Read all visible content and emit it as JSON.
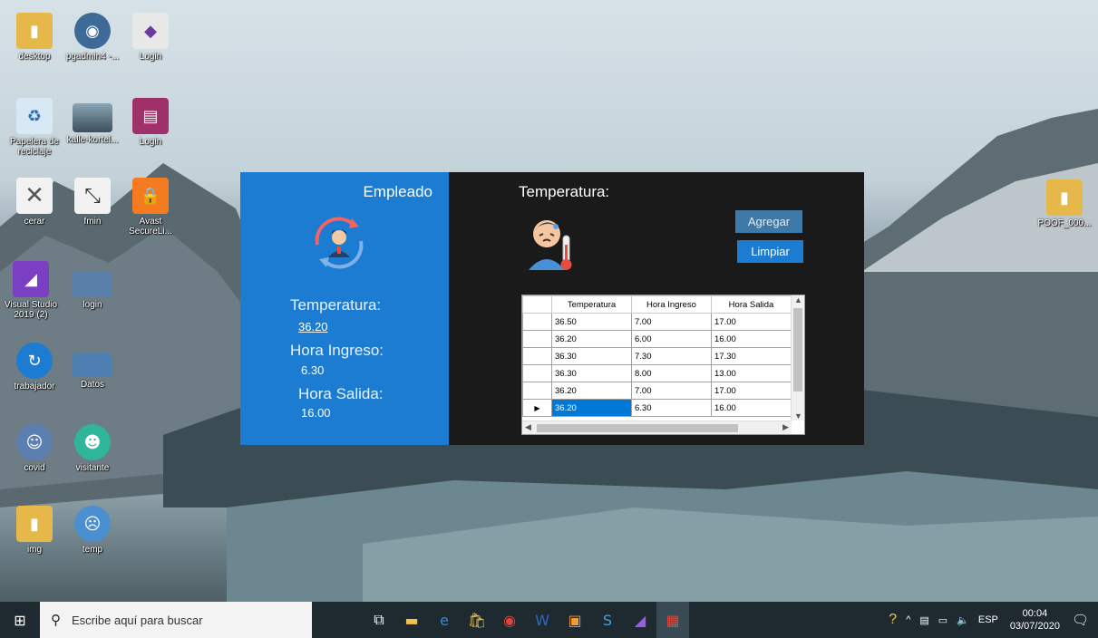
{
  "desktop": {
    "icons": [
      {
        "label": "desktop"
      },
      {
        "label": "pgadmin4 -..."
      },
      {
        "label": "Login"
      },
      {
        "label": "Papelera de reciclaje"
      },
      {
        "label": "kalle-kortel..."
      },
      {
        "label": "Login"
      },
      {
        "label": "cerar"
      },
      {
        "label": "fmin"
      },
      {
        "label": "Avast SecureLi..."
      },
      {
        "label": "Visual Studio 2019 (2)"
      },
      {
        "label": "login"
      },
      {
        "label": "trabajador"
      },
      {
        "label": "Datos"
      },
      {
        "label": "covid"
      },
      {
        "label": "visitante"
      },
      {
        "label": "img"
      },
      {
        "label": "temp"
      },
      {
        "label": "POOF_000..."
      }
    ]
  },
  "app": {
    "left": {
      "title": "Empleado",
      "temperatura_label": "Temperatura:",
      "temperatura_value": "36.20",
      "hora_ingreso_label": "Hora Ingreso:",
      "hora_ingreso_value": "6.30",
      "hora_salida_label": "Hora Salida:",
      "hora_salida_value": "16.00"
    },
    "right": {
      "title": "Temperatura:",
      "agregar_label": "Agregar",
      "limpiar_label": "Limpiar",
      "grid": {
        "columns": [
          "Temperatura",
          "Hora Ingreso",
          "Hora Salida"
        ],
        "rows": [
          [
            "36.50",
            "7.00",
            "17.00"
          ],
          [
            "36.20",
            "6.00",
            "16.00"
          ],
          [
            "36.30",
            "7.30",
            "17.30"
          ],
          [
            "36.30",
            "8.00",
            "13.00"
          ],
          [
            "36.20",
            "7.00",
            "17.00"
          ],
          [
            "36.20",
            "6.30",
            "16.00"
          ]
        ]
      }
    }
  },
  "taskbar": {
    "search_placeholder": "Escribe aquí para buscar",
    "language": "ESP",
    "time": "00:04",
    "date": "03/07/2020"
  },
  "colors": {
    "accent_blue": "#1b7cd1",
    "dark_pane": "#1a1a1a",
    "selection": "#0078d7"
  }
}
